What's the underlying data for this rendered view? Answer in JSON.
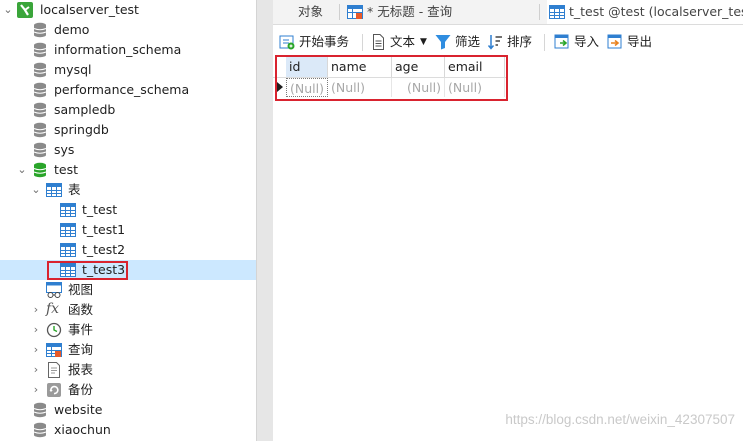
{
  "tree": {
    "connection": "localserver_test",
    "databases_before": [
      "demo",
      "information_schema",
      "mysql",
      "performance_schema",
      "sampledb",
      "springdb",
      "sys"
    ],
    "open_db": "test",
    "tables_group": "表",
    "tables": [
      "t_test",
      "t_test1",
      "t_test2",
      "t_test3"
    ],
    "selected_table": "t_test3",
    "groups": [
      "视图",
      "函数",
      "事件",
      "查询",
      "报表",
      "备份"
    ],
    "databases_after": [
      "website",
      "xiaochun"
    ]
  },
  "tabs": {
    "objects": "对象",
    "query": "* 无标题 - 查询",
    "table": "t_test @test (localserver_tes..."
  },
  "toolbar": {
    "begin_transaction": "开始事务",
    "text": "文本",
    "filter": "筛选",
    "sort": "排序",
    "import": "导入",
    "export": "导出"
  },
  "grid": {
    "columns": [
      "id",
      "name",
      "age",
      "email"
    ],
    "rows": [
      [
        "(Null)",
        "(Null)",
        "(Null)",
        "(Null)"
      ]
    ]
  },
  "watermark": "https://blog.csdn.net/weixin_42307507",
  "colors": {
    "selection": "#cce8ff",
    "highlight_box": "#d9232f",
    "db_green": "#2aa52a",
    "table_blue": "#2f7fd0"
  }
}
